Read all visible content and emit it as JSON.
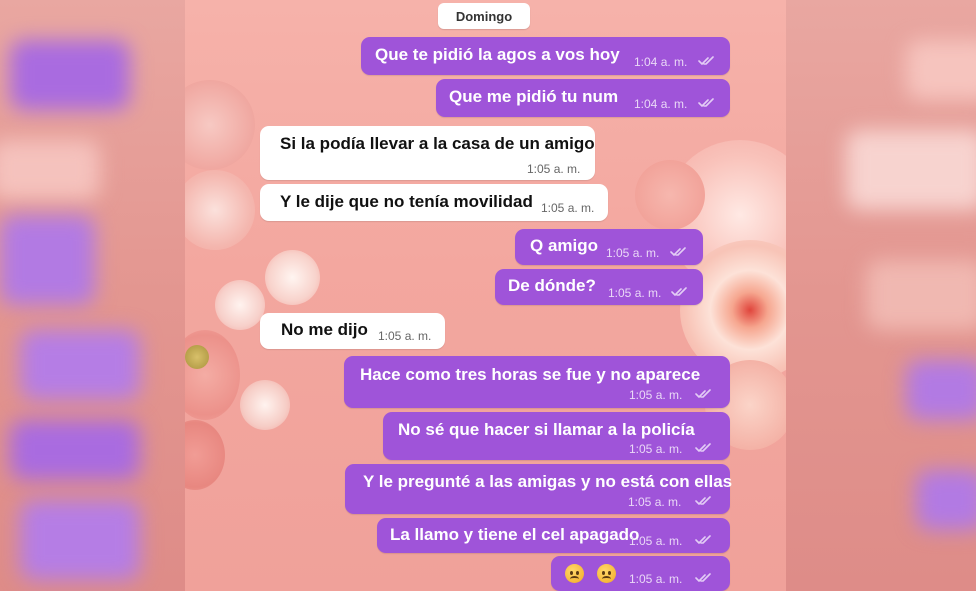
{
  "date_chip": "Domingo",
  "messages": [
    {
      "dir": "out",
      "text": "Que te pidió la agos a vos hoy",
      "time": "1:04 a. m."
    },
    {
      "dir": "out",
      "text": "Que me pidió tu num",
      "time": "1:04 a. m."
    },
    {
      "dir": "in",
      "text": "Si la podía llevar a la casa de un amigo",
      "time": "1:05 a. m."
    },
    {
      "dir": "in",
      "text": "Y le dije que no tenía movilidad",
      "time": "1:05 a. m."
    },
    {
      "dir": "out",
      "text": "Q amigo",
      "time": "1:05 a. m."
    },
    {
      "dir": "out",
      "text": "De dónde?",
      "time": "1:05 a. m."
    },
    {
      "dir": "in",
      "text": "No me dijo",
      "time": "1:05 a. m."
    },
    {
      "dir": "out",
      "text": "Hace como tres horas se fue y no aparece",
      "time": "1:05 a. m."
    },
    {
      "dir": "out",
      "text": "No sé que hacer si llamar a la policía",
      "time": "1:05 a. m."
    },
    {
      "dir": "out",
      "text": "Y le pregunté a las amigas y no está con ellas",
      "time": "1:05 a. m."
    },
    {
      "dir": "out",
      "text": "La llamo y tiene el cel apagado",
      "time": "1:05 a. m."
    },
    {
      "dir": "out",
      "text": "",
      "emoji": [
        "worried-face",
        "worried-face"
      ],
      "time": "1:05 a. m."
    }
  ],
  "colors": {
    "outgoing": "#9f54d9",
    "incoming": "#ffffff",
    "background": "#f3a79f",
    "read_ticks": "#e3ccf5"
  }
}
